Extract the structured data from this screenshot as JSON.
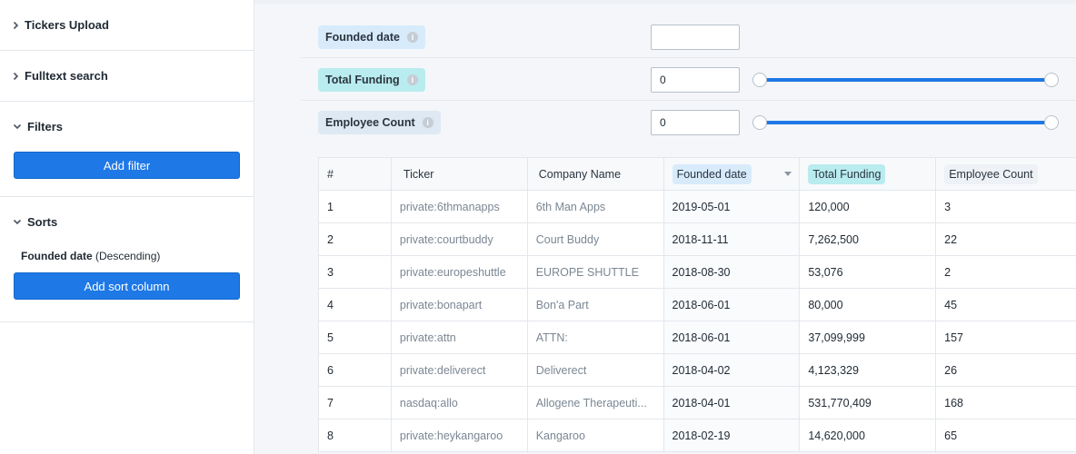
{
  "sidebar": {
    "tickers_upload": "Tickers Upload",
    "fulltext_search": "Fulltext search",
    "filters": "Filters",
    "add_filter": "Add filter",
    "sorts": "Sorts",
    "sort_field": "Founded date",
    "sort_dir": "(Descending)",
    "add_sort_column": "Add sort column"
  },
  "filters": {
    "founded": {
      "label": "Founded date",
      "value": ""
    },
    "funding": {
      "label": "Total Funding",
      "value": "0"
    },
    "employees": {
      "label": "Employee Count",
      "value": "0"
    }
  },
  "table": {
    "headers": [
      "#",
      "Ticker",
      "Company Name",
      "Founded date",
      "Total Funding",
      "Employee Count"
    ],
    "rows": [
      [
        "1",
        "private:6thmanapps",
        "6th Man Apps",
        "2019-05-01",
        "120,000",
        "3"
      ],
      [
        "2",
        "private:courtbuddy",
        "Court Buddy",
        "2018-11-11",
        "7,262,500",
        "22"
      ],
      [
        "3",
        "private:europeshuttle",
        "EUROPE SHUTTLE",
        "2018-08-30",
        "53,076",
        "2"
      ],
      [
        "4",
        "private:bonapart",
        "Bon'a Part",
        "2018-06-01",
        "80,000",
        "45"
      ],
      [
        "5",
        "private:attn",
        "ATTN:",
        "2018-06-01",
        "37,099,999",
        "157"
      ],
      [
        "6",
        "private:deliverect",
        "Deliverect",
        "2018-04-02",
        "4,123,329",
        "26"
      ],
      [
        "7",
        "nasdaq:allo",
        "Allogene Therapeuti...",
        "2018-04-01",
        "531,770,409",
        "168"
      ],
      [
        "8",
        "private:heykangaroo",
        "Kangaroo",
        "2018-02-19",
        "14,620,000",
        "65"
      ]
    ]
  },
  "colors": {
    "accent": "#1e78e6",
    "date_tag": "#d8ebfb",
    "funding_tag": "#b9ecee"
  }
}
